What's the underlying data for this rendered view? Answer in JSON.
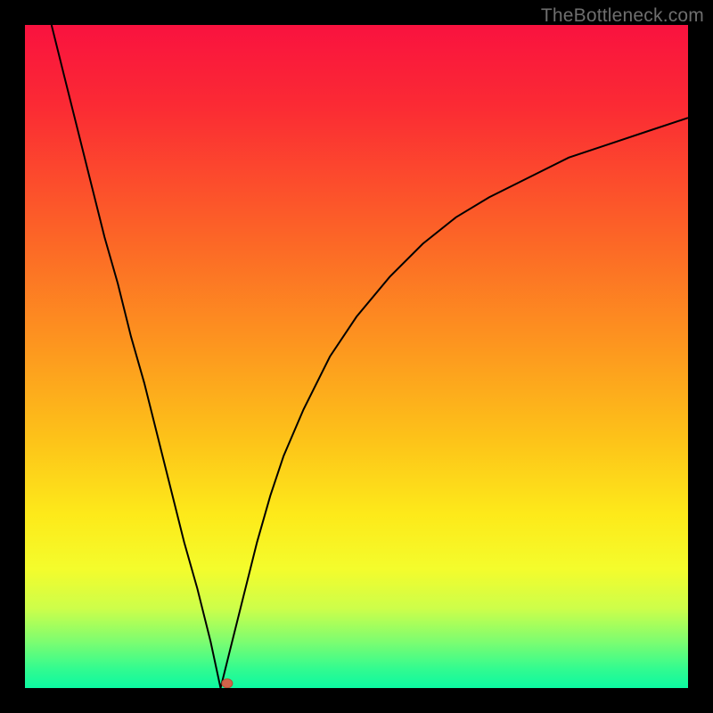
{
  "watermark": "TheBottleneck.com",
  "colors": {
    "frame": "#000000",
    "curve": "#000000",
    "marker_fill": "#d0634a",
    "marker_stroke": "#b24f36",
    "gradient_stops": [
      {
        "offset": 0.0,
        "color": "#f9123f"
      },
      {
        "offset": 0.12,
        "color": "#fb2a34"
      },
      {
        "offset": 0.3,
        "color": "#fc5f28"
      },
      {
        "offset": 0.48,
        "color": "#fd951f"
      },
      {
        "offset": 0.62,
        "color": "#fdc119"
      },
      {
        "offset": 0.74,
        "color": "#fdea1a"
      },
      {
        "offset": 0.82,
        "color": "#f4fc2c"
      },
      {
        "offset": 0.88,
        "color": "#cdfe4a"
      },
      {
        "offset": 0.93,
        "color": "#7dfd70"
      },
      {
        "offset": 0.97,
        "color": "#34fb8f"
      },
      {
        "offset": 1.0,
        "color": "#0cf9a1"
      }
    ]
  },
  "chart_data": {
    "type": "line",
    "title": "",
    "xlabel": "",
    "ylabel": "",
    "xlim": [
      0,
      100
    ],
    "ylim": [
      0,
      100
    ],
    "minimum": {
      "x": 29.5,
      "y": 0
    },
    "marker": {
      "x": 30.5,
      "y": 0.7
    },
    "series": [
      {
        "name": "curve",
        "x": [
          4,
          6,
          8,
          10,
          12,
          14,
          16,
          18,
          20,
          22,
          24,
          26,
          28,
          29.5,
          31,
          33,
          35,
          37,
          39,
          42,
          46,
          50,
          55,
          60,
          65,
          70,
          76,
          82,
          88,
          94,
          100
        ],
        "y": [
          100,
          92,
          84,
          76,
          68,
          61,
          53,
          46,
          38,
          30,
          22,
          15,
          7,
          0,
          6,
          14,
          22,
          29,
          35,
          42,
          50,
          56,
          62,
          67,
          71,
          74,
          77,
          80,
          82,
          84,
          86
        ]
      }
    ],
    "notes": "Values estimated from pixels; x,y normalized 0–100 with origin at bottom-left of the colored plot area."
  }
}
